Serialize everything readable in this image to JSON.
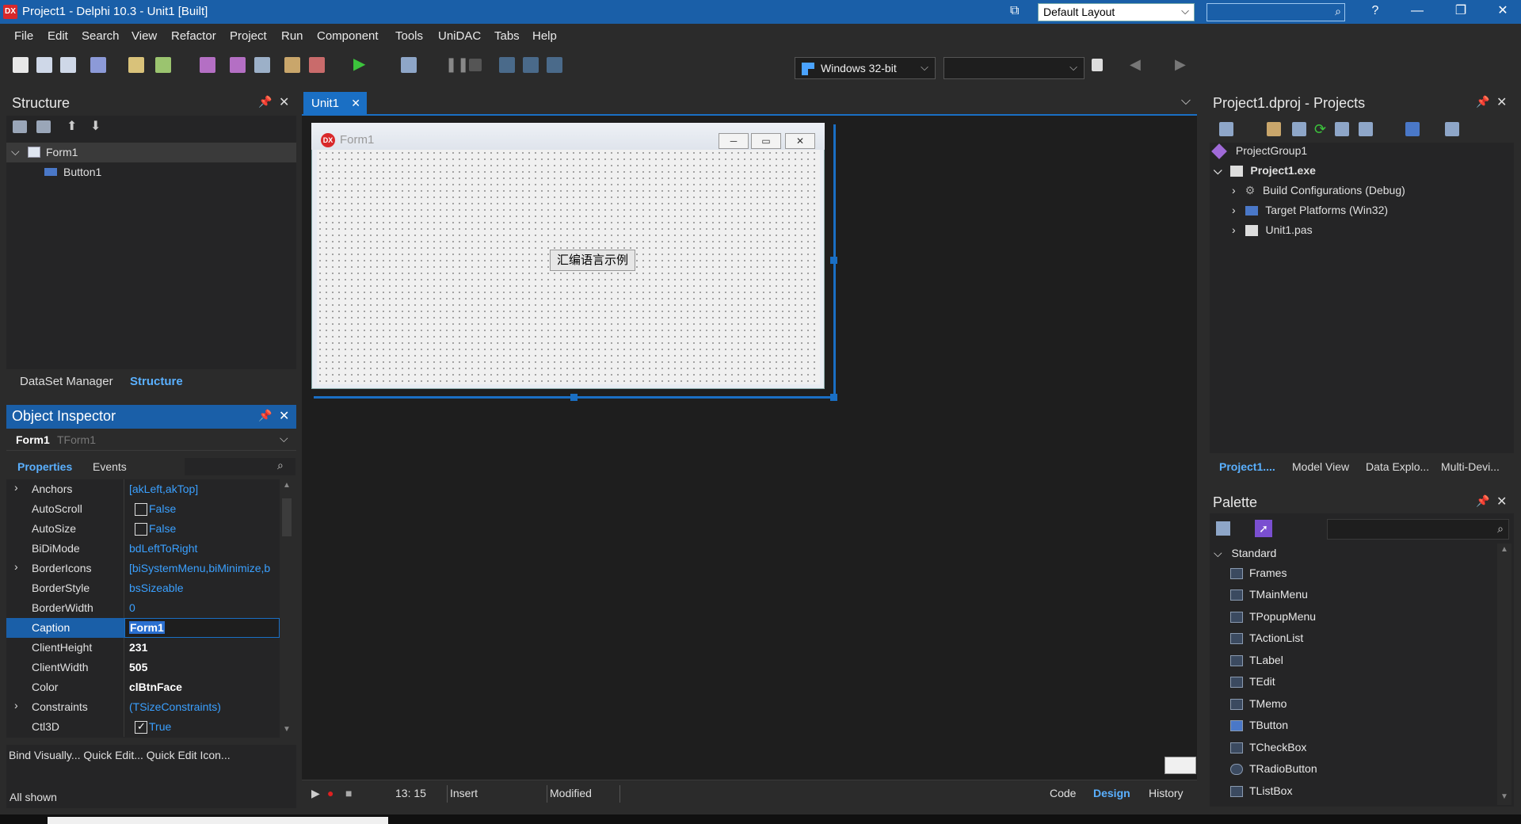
{
  "window": {
    "title": "Project1 - Delphi 10.3 - Unit1 [Built]",
    "app_icon": "DX",
    "layout": "Default Layout"
  },
  "menu": [
    "File",
    "Edit",
    "Search",
    "View",
    "Refactor",
    "Project",
    "Run",
    "Component",
    "Tools",
    "UniDAC",
    "Tabs",
    "Help"
  ],
  "toolbar": {
    "platform": "Windows 32-bit"
  },
  "structure": {
    "title": "Structure",
    "items": [
      {
        "label": "Form1"
      },
      {
        "label": "Button1"
      }
    ],
    "tabs": [
      "DataSet Manager",
      "Structure"
    ]
  },
  "object_inspector": {
    "title": "Object Inspector",
    "selected_name": "Form1",
    "selected_type": "TForm1",
    "tabs": [
      "Properties",
      "Events"
    ],
    "rows": [
      {
        "name": "Anchors",
        "value": "[akLeft,akTop]",
        "expandable": true
      },
      {
        "name": "AutoScroll",
        "value": "False",
        "check": false
      },
      {
        "name": "AutoSize",
        "value": "False",
        "check": false
      },
      {
        "name": "BiDiMode",
        "value": "bdLeftToRight"
      },
      {
        "name": "BorderIcons",
        "value": "[biSystemMenu,biMinimize,b",
        "expandable": true
      },
      {
        "name": "BorderStyle",
        "value": "bsSizeable"
      },
      {
        "name": "BorderWidth",
        "value": "0"
      },
      {
        "name": "Caption",
        "value": "Form1",
        "selected": true
      },
      {
        "name": "ClientHeight",
        "value": "231",
        "bold": true
      },
      {
        "name": "ClientWidth",
        "value": "505",
        "bold": true
      },
      {
        "name": "Color",
        "value": "clBtnFace",
        "bold": true
      },
      {
        "name": "Constraints",
        "value": "(TSizeConstraints)",
        "expandable": true
      },
      {
        "name": "Ctl3D",
        "value": "True",
        "check": true
      }
    ],
    "footer_links": "Bind Visually... Quick Edit... Quick Edit Icon...",
    "footer_status": "All shown"
  },
  "editor": {
    "tab": "Unit1",
    "form_title": "Form1",
    "form_icon": "DX",
    "button_caption": "汇编语言示例"
  },
  "status": {
    "position": "13:  15",
    "mode": "Insert",
    "modified": "Modified",
    "views": [
      "Code",
      "Design",
      "History"
    ]
  },
  "projects": {
    "title": "Project1.dproj - Projects",
    "tree": [
      {
        "label": "ProjectGroup1"
      },
      {
        "label": "Project1.exe"
      },
      {
        "label": "Build Configurations (Debug)"
      },
      {
        "label": "Target Platforms (Win32)"
      },
      {
        "label": "Unit1.pas"
      }
    ],
    "tabs": [
      "Project1....",
      "Model View",
      "Data Explo...",
      "Multi-Devi..."
    ]
  },
  "palette": {
    "title": "Palette",
    "category": "Standard",
    "items": [
      "Frames",
      "TMainMenu",
      "TPopupMenu",
      "TActionList",
      "TLabel",
      "TEdit",
      "TMemo",
      "TButton",
      "TCheckBox",
      "TRadioButton",
      "TListBox"
    ]
  }
}
